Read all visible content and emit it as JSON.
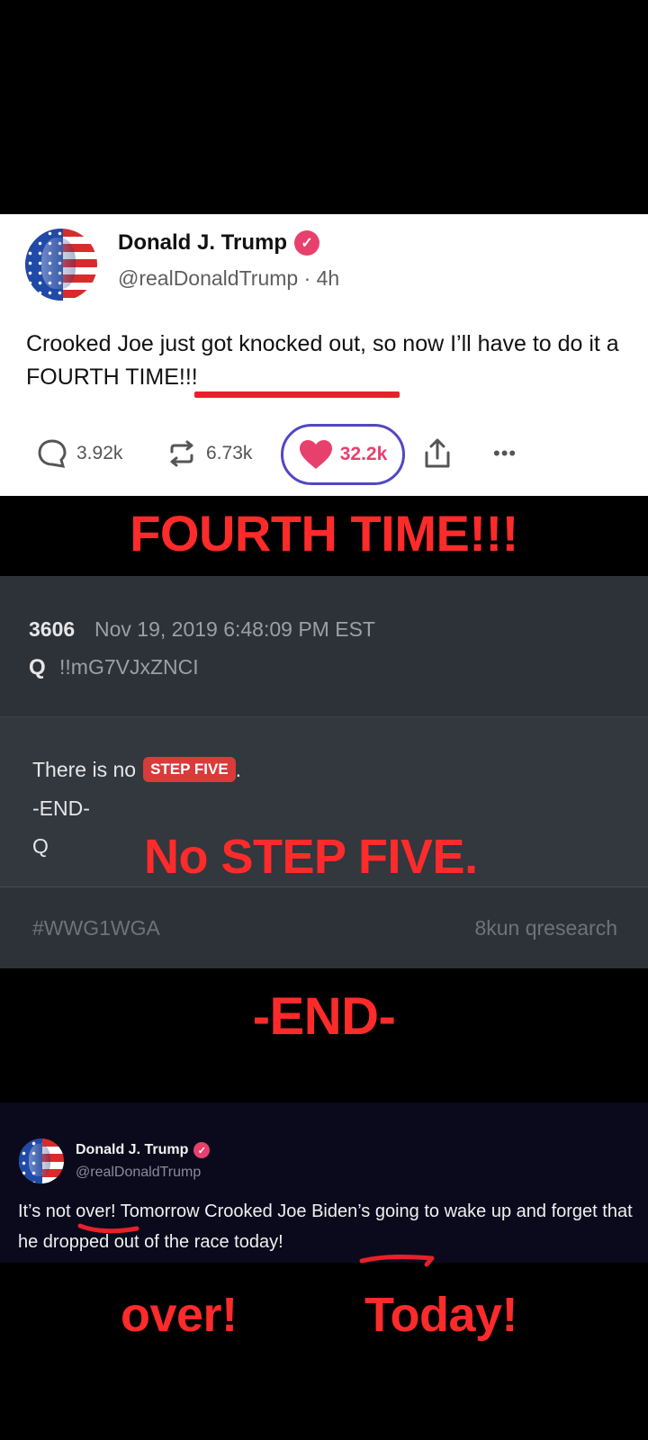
{
  "tweet1": {
    "name": "Donald J. Trump",
    "handle_time": "@realDonaldTrump · 4h",
    "body": "Crooked Joe just got knocked out, so now I’ll have to do it a FOURTH TIME!!!",
    "replies": "3.92k",
    "retweets": "6.73k",
    "likes": "32.2k",
    "more": "•••"
  },
  "captions": {
    "fourth": "FOURTH TIME!!!",
    "no_step": "No STEP FIVE.",
    "end": "-END-",
    "over": "over!",
    "today": "Today!"
  },
  "qdrop": {
    "number": "3606",
    "date": "Nov 19, 2019 6:48:09 PM EST",
    "author": "Q",
    "tripcode": "!!mG7VJxZNCI",
    "line1_prefix": "There is no",
    "badge": "STEP FIVE",
    "line1_suffix": ".",
    "line2": "-END-",
    "line3": "Q",
    "hashtag": "#WWG1WGA",
    "source": "8kun qresearch"
  },
  "tweet2": {
    "name": "Donald J. Trump",
    "handle": "@realDonaldTrump",
    "body": "It’s not over! Tomorrow Crooked Joe Biden’s going to wake up and forget that he dropped out of the race today!"
  },
  "colors": {
    "caption_red": "#ff2b2b",
    "verified_pink": "#e8406d",
    "like_outline": "#5147c5",
    "q_card_bg": "#2d3138",
    "tweet2_bg": "#0b0a1c"
  }
}
